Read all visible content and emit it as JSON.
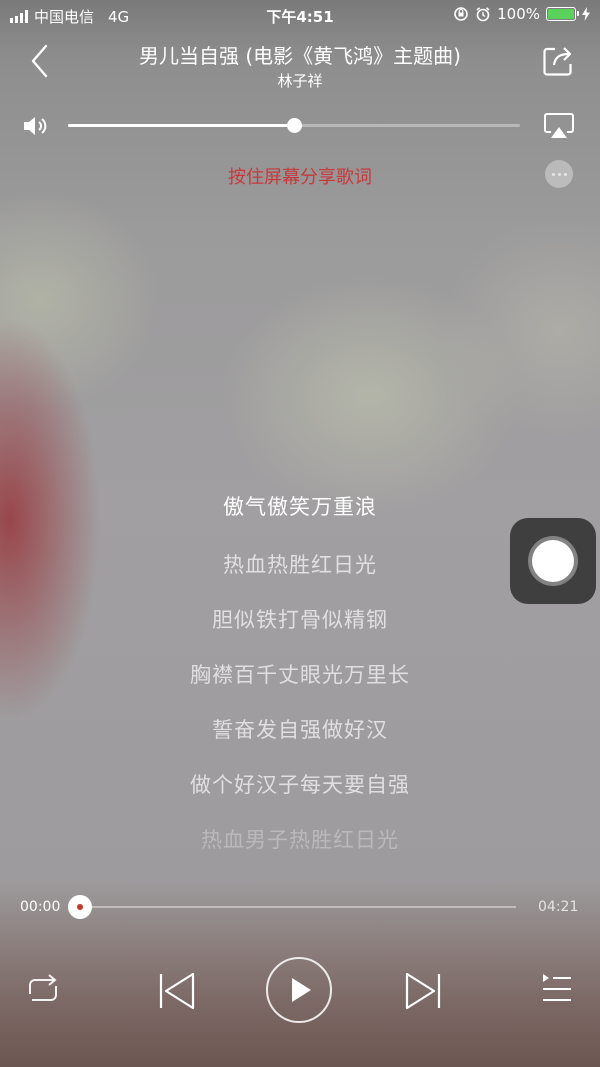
{
  "status_bar": {
    "carrier": "中国电信",
    "network": "4G",
    "time": "下午4:51",
    "battery": "100%"
  },
  "header": {
    "title": "男儿当自强 (电影《黄飞鸿》主题曲)",
    "artist": "林子祥"
  },
  "volume": {
    "level": 0.5
  },
  "share_hint": "按住屏幕分享歌词",
  "lyrics": [
    "傲气傲笑万重浪",
    "热血热胜红日光",
    "胆似铁打骨似精钢",
    "胸襟百千丈眼光万里长",
    "誓奋发自强做好汉",
    "做个好汉子每天要自强",
    "热血男子热胜红日光"
  ],
  "current_lyric_index": 0,
  "playback": {
    "elapsed": "00:00",
    "total": "04:21",
    "progress": 0
  },
  "colors": {
    "accent_red": "#c8383a",
    "battery_green": "#5ad15a"
  },
  "icons": [
    "back-icon",
    "share-icon",
    "volume-icon",
    "airplay-icon",
    "more-icon",
    "repeat-icon",
    "previous-icon",
    "play-icon",
    "next-icon",
    "playlist-icon"
  ]
}
